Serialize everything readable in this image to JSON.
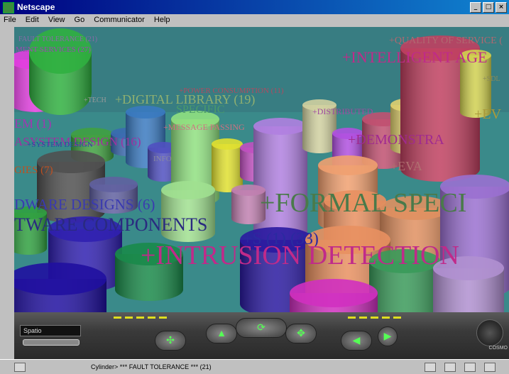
{
  "window": {
    "title": "Netscape"
  },
  "menu": [
    "File",
    "Edit",
    "View",
    "Go",
    "Communicator",
    "Help"
  ],
  "scene": {
    "labels": [
      {
        "text": "FAULT TOLERANCE (21)",
        "color": "#8a6aa8"
      },
      {
        "text": "+QUALITY OF SERVICE (",
        "color": "#b06870"
      },
      {
        "text": "MENT SERVICES (27)",
        "color": "#9a4ab0"
      },
      {
        "text": "+INTELLIGENT AGE",
        "color": "#c02a8a"
      },
      {
        "text": "+SDL",
        "color": "#8a8a5a"
      },
      {
        "text": "+POWER CONSUMPTION (11)",
        "color": "#b04a60"
      },
      {
        "text": "+TECH",
        "color": "#9a9a9a"
      },
      {
        "text": "+DIGITAL LIBRARY (19)",
        "color": "#90b070"
      },
      {
        "text": "SPECIFIC",
        "color": "#4a9a6a"
      },
      {
        "text": "+DISTRIBUTED",
        "color": "#a04aa0"
      },
      {
        "text": "+EV",
        "color": "#aa9a3a"
      },
      {
        "text": "EM (1)",
        "color": "#a038b0"
      },
      {
        "text": "+MESSAGE PASSING",
        "color": "#d07080"
      },
      {
        "text": "ASYSTEM DESIGN (16)",
        "color": "#a030a0"
      },
      {
        "text": "+SYSTEM DESIGN",
        "color": "#2050a0"
      },
      {
        "text": "+DEMONSTRA",
        "color": "#a02a90"
      },
      {
        "text": "INFO",
        "color": "#8a8aa0"
      },
      {
        "text": "+EVA",
        "color": "#b07070"
      },
      {
        "text": "GIES (7)",
        "color": "#c05020"
      },
      {
        "text": "DWARE DESIGNS (6)",
        "color": "#3a3ab0"
      },
      {
        "text": "+FORMAL SPECI",
        "color": "#4a7a4a"
      },
      {
        "text": "TWARE COMPONENTS",
        "color": "#2a2a80"
      },
      {
        "text": "+S (1) (33)",
        "color": "#2a2aa0"
      },
      {
        "text": "+INTRUSION DETECTION",
        "color": "#c02a8a"
      }
    ]
  },
  "controls": {
    "viewpoint_label": "Spatio",
    "logo_text": "COSMO"
  },
  "status": {
    "text": "Cylinder> *** FAULT TOLERANCE *** (21)"
  }
}
